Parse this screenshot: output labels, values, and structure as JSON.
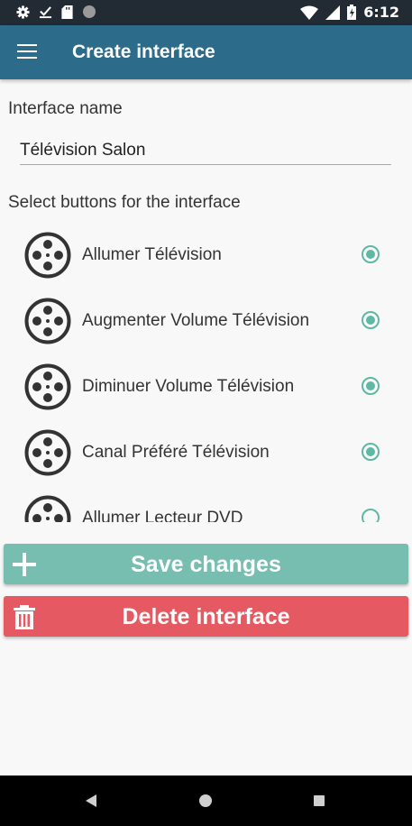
{
  "status_bar": {
    "time": "6:12",
    "icons": [
      "gear-icon",
      "check-download-icon",
      "sd-card-icon",
      "circle-icon",
      "wifi-icon",
      "signal-icon",
      "battery-icon"
    ]
  },
  "app_bar": {
    "title": "Create interface",
    "menu_icon": "hamburger-menu-icon"
  },
  "form": {
    "name_label": "Interface name",
    "name_value": "Télévision Salon",
    "buttons_label": "Select buttons for the interface"
  },
  "button_list": {
    "items": [
      {
        "label": "Allumer Télévision",
        "selected": true,
        "icon": "film-reel-icon"
      },
      {
        "label": "Augmenter Volume Télévision",
        "selected": true,
        "icon": "film-reel-icon"
      },
      {
        "label": "Diminuer Volume Télévision",
        "selected": true,
        "icon": "film-reel-icon"
      },
      {
        "label": "Canal Préféré Télévision",
        "selected": true,
        "icon": "film-reel-icon"
      },
      {
        "label": "Allumer Lecteur DVD",
        "selected": false,
        "icon": "film-reel-icon"
      }
    ]
  },
  "actions": {
    "save_label": "Save changes",
    "delete_label": "Delete interface"
  },
  "colors": {
    "status_bar": "#222a33",
    "app_bar": "#2d6b8a",
    "accent": "#5fb8a5",
    "save_button": "#77bdb0",
    "delete_button": "#e55a62"
  },
  "nav_bar": {
    "icons": [
      "back-icon",
      "home-icon",
      "recents-icon"
    ]
  }
}
